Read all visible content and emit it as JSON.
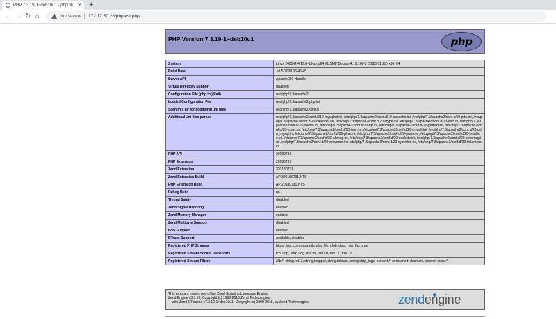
{
  "browser": {
    "tab_title": "PHP 7.3.19-1~deb10u1 - phpinfo()",
    "tab_close": "✕",
    "new_tab": "+",
    "back": "←",
    "forward": "→",
    "reload": "↻",
    "home": "⌂",
    "security_label": "Not secure",
    "url": "172.17.50.28/phptest.php"
  },
  "header": {
    "title": "PHP Version 7.3.19-1~deb10u1",
    "logo_text": "php"
  },
  "rows": [
    {
      "k": "System",
      "v": "Linux 2480-R 4.19.0-13-amd64 #1 SMP Debian 4.19.160-2 (2020-11-28) x86_64"
    },
    {
      "k": "Build Date",
      "v": "Jul 5 2020 06:46:45"
    },
    {
      "k": "Server API",
      "v": "Apache 2.0 Handler"
    },
    {
      "k": "Virtual Directory Support",
      "v": "disabled"
    },
    {
      "k": "Configuration File (php.ini) Path",
      "v": "/etc/php/7.3/apache2"
    },
    {
      "k": "Loaded Configuration File",
      "v": "/etc/php/7.3/apache2/php.ini"
    },
    {
      "k": "Scan this dir for additional .ini files",
      "v": "/etc/php/7.3/apache2/conf.d"
    },
    {
      "k": "Additional .ini files parsed",
      "v": "/etc/php/7.3/apache2/conf.d/10-mysqlnd.ini, /etc/php/7.3/apache2/conf.d/10-opcache.ini, /etc/php/7.3/apache2/conf.d/10-pdo.ini, /etc/php/7.3/apache2/conf.d/20-calendar.ini, /etc/php/7.3/apache2/conf.d/20-ctype.ini, /etc/php/7.3/apache2/conf.d/20-exif.ini, /etc/php/7.3/apache2/conf.d/20-fileinfo.ini, /etc/php/7.3/apache2/conf.d/20-ftp.ini, /etc/php/7.3/apache2/conf.d/20-gettext.ini, /etc/php/7.3/apache2/conf.d/20-iconv.ini, /etc/php/7.3/apache2/conf.d/20-json.ini, /etc/php/7.3/apache2/conf.d/20-mysqli.ini, /etc/php/7.3/apache2/conf.d/20-pdo_mysql.ini, /etc/php/7.3/apache2/conf.d/20-phar.ini, /etc/php/7.3/apache2/conf.d/20-posix.ini, /etc/php/7.3/apache2/conf.d/20-readline.ini, /etc/php/7.3/apache2/conf.d/20-shmop.ini, /etc/php/7.3/apache2/conf.d/20-sockets.ini, /etc/php/7.3/apache2/conf.d/20-sysvmsg.ini, /etc/php/7.3/apache2/conf.d/20-sysvsem.ini, /etc/php/7.3/apache2/conf.d/20-sysvshm.ini, /etc/php/7.3/apache2/conf.d/20-tokenizer.ini"
    },
    {
      "k": "PHP API",
      "v": "20180731"
    },
    {
      "k": "PHP Extension",
      "v": "20180731"
    },
    {
      "k": "Zend Extension",
      "v": "320180731"
    },
    {
      "k": "Zend Extension Build",
      "v": "API320180731,NTS"
    },
    {
      "k": "PHP Extension Build",
      "v": "API20180731,NTS"
    },
    {
      "k": "Debug Build",
      "v": "no"
    },
    {
      "k": "Thread Safety",
      "v": "disabled"
    },
    {
      "k": "Zend Signal Handling",
      "v": "enabled"
    },
    {
      "k": "Zend Memory Manager",
      "v": "enabled"
    },
    {
      "k": "Zend Multibyte Support",
      "v": "disabled"
    },
    {
      "k": "IPv6 Support",
      "v": "enabled"
    },
    {
      "k": "DTrace Support",
      "v": "available, disabled"
    },
    {
      "k": "Registered PHP Streams",
      "v": "https, ftps, compress.zlib, php, file, glob, data, http, ftp, phar"
    },
    {
      "k": "Registered Stream Socket Transports",
      "v": "tcp, udp, unix, udg, ssl, tls, tlsv1.0, tlsv1.1, tlsv1.2"
    },
    {
      "k": "Registered Stream Filters",
      "v": "zlib.*, string.rot13, string.toupper, string.tolower, string.strip_tags, convert.*, consumed, dechunk, convert.iconv.*"
    }
  ],
  "footer": {
    "line1": "This program makes use of the Zend Scripting Language Engine:",
    "line2": "Zend Engine v3.3.19, Copyright (c) 1998-2018 Zend Technologies",
    "line3": "    with Zend OPcache v7.3.19-1~deb10u1, Copyright (c) 1999-2018, by Zend Technologies",
    "logo_part1": "zend",
    "logo_part2": "engine"
  }
}
